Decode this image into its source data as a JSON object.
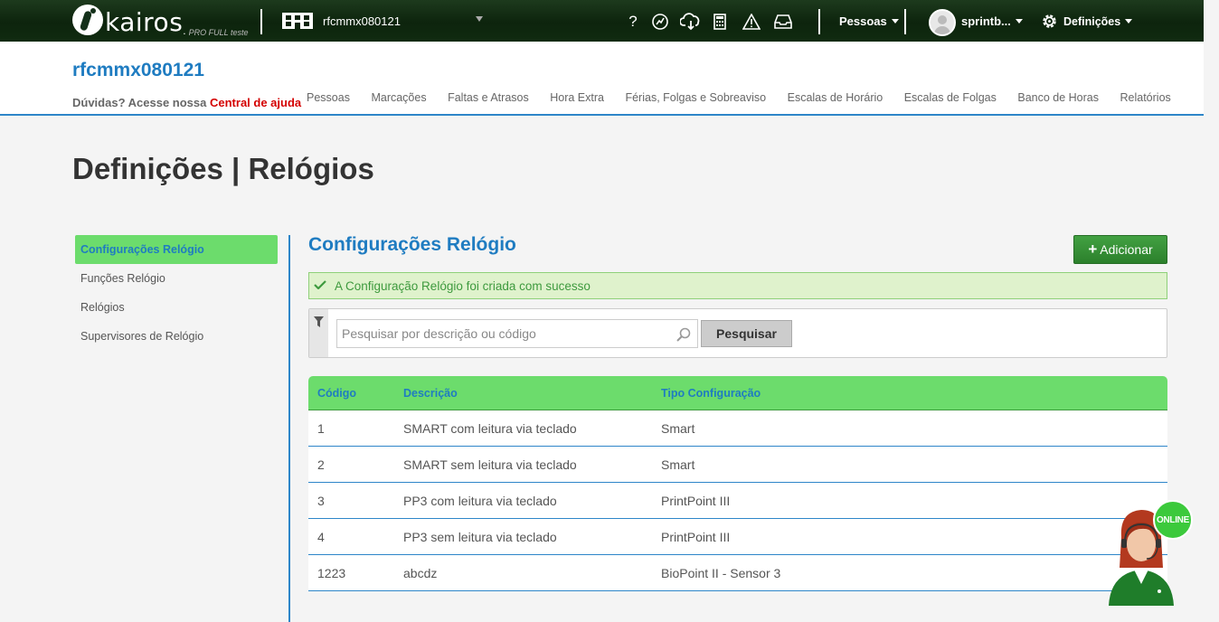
{
  "topbar": {
    "logo_text": "kairos",
    "logo_sub": "PRO FULL teste",
    "company_name": "rfcmmx080121",
    "menu_pessoas": "Pessoas",
    "user_name": "sprintb...",
    "menu_definicoes": "Definições",
    "icons": [
      "help-icon",
      "support-icon",
      "cloud-download-icon",
      "calculator-icon",
      "warning-icon",
      "inbox-icon",
      "gear-icon"
    ]
  },
  "header": {
    "tenant": "rfcmmx080121",
    "help_prefix": "Dúvidas? Acesse nossa",
    "help_link": "Central de ajuda",
    "nav": [
      "Pessoas",
      "Marcações",
      "Faltas e Atrasos",
      "Hora Extra",
      "Férias, Folgas e Sobreaviso",
      "Escalas de Horário",
      "Escalas de Folgas",
      "Banco de Horas",
      "Relatórios"
    ]
  },
  "page_title": "Definições | Relógios",
  "sidebar": {
    "items": [
      {
        "label": "Configurações Relógio",
        "active": true
      },
      {
        "label": "Funções Relógio",
        "active": false
      },
      {
        "label": "Relógios",
        "active": false
      },
      {
        "label": "Supervisores de Relógio",
        "active": false
      }
    ]
  },
  "main": {
    "title": "Configurações Relógio",
    "add_button": "Adicionar",
    "alert": "A Configuração Relógio foi criada com sucesso",
    "search_placeholder": "Pesquisar por descrição ou código",
    "search_button": "Pesquisar",
    "table": {
      "headers": [
        "Código",
        "Descrição",
        "Tipo Configuração"
      ],
      "rows": [
        [
          "1",
          "SMART com leitura via teclado",
          "Smart"
        ],
        [
          "2",
          "SMART sem leitura via teclado",
          "Smart"
        ],
        [
          "3",
          "PP3 com leitura via teclado",
          "PrintPoint III"
        ],
        [
          "4",
          "PP3 sem leitura via teclado",
          "PrintPoint III"
        ],
        [
          "1223",
          "abcdz",
          "BioPoint II - Sensor 3"
        ]
      ]
    }
  },
  "online_badge": "ONLINE",
  "colors": {
    "accent_blue": "#1f7cc1",
    "header_green": "#6cdc6c",
    "button_green": "#2c802c",
    "help_red": "#d40000"
  }
}
